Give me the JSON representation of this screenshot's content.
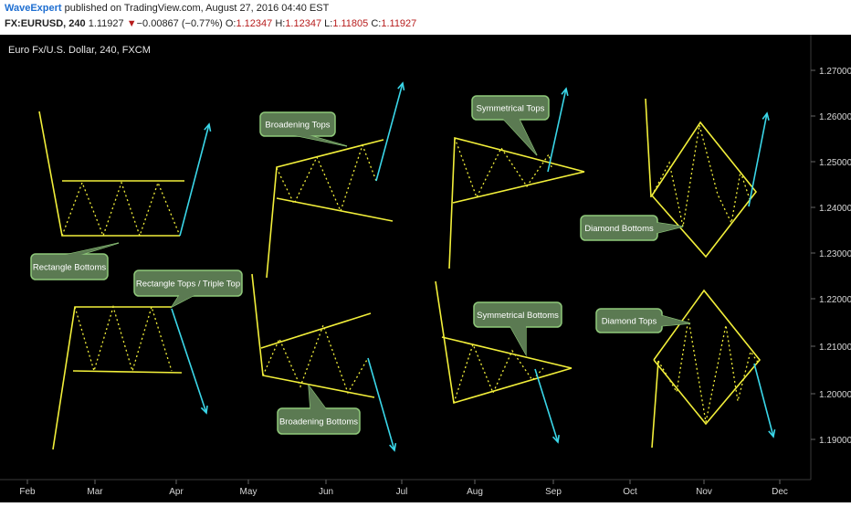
{
  "header": {
    "author": "WaveExpert",
    "published_text": "published on TradingView.com, August 27, 2016 04:40 EST",
    "symbol": "FX:EURUSD, 240",
    "last": "1.11927",
    "down_arrow": "▼",
    "change": "−0.00867 (−0.77%)",
    "o_label": "O:",
    "o_val": "1.12347",
    "h_label": "H:",
    "h_val": "1.12347",
    "l_label": "L:",
    "l_val": "1.11805",
    "c_label": "C:",
    "c_val": "1.11927"
  },
  "colors": {
    "background": "#000000",
    "pattern": "#f2ef3a",
    "arrow": "#3ad6e8",
    "callout_fill": "#5b7a52",
    "callout_border": "#8fc97a",
    "axis_text": "#d8d8d8"
  },
  "chart_data": {
    "type": "line",
    "title": "Euro Fx/U.S. Dollar, 240, FXCM",
    "x_ticks": [
      "Feb",
      "Mar",
      "Apr",
      "May",
      "Jun",
      "Jul",
      "Aug",
      "Sep",
      "Oct",
      "Nov",
      "Dec"
    ],
    "y_ticks": [
      "1.27000",
      "1.26000",
      "1.25000",
      "1.24000",
      "1.23000",
      "1.22000",
      "1.21000",
      "1.20000",
      "1.19000"
    ],
    "ylim": [
      1.183,
      1.276
    ],
    "grid": false,
    "annotations": [
      "Rectangle Bottoms",
      "Rectangle Tops / Triple Top",
      "Broadening Tops",
      "Broadening Bottoms",
      "Symmetrical Tops",
      "Symmetrical Bottoms",
      "Diamond Bottoms",
      "Diamond Tops"
    ]
  }
}
